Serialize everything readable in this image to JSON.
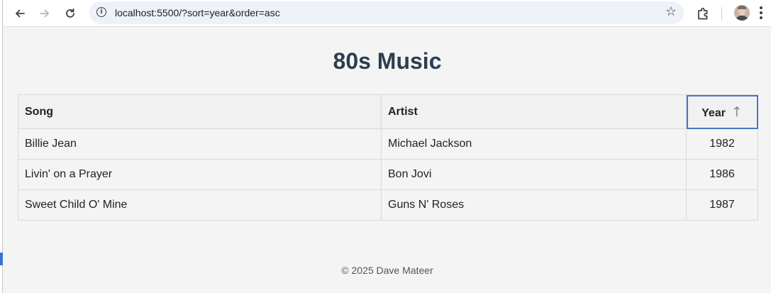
{
  "browser": {
    "url": "localhost:5500/?sort=year&order=asc"
  },
  "page": {
    "title": "80s Music",
    "footer": "© 2025 Dave Mateer"
  },
  "table": {
    "headers": {
      "song": "Song",
      "artist": "Artist",
      "year": "Year",
      "year_sort_indicator": "↑"
    },
    "rows": [
      {
        "song": "Billie Jean",
        "artist": "Michael Jackson",
        "year": "1982"
      },
      {
        "song": "Livin' on a Prayer",
        "artist": "Bon Jovi",
        "year": "1986"
      },
      {
        "song": "Sweet Child O' Mine",
        "artist": "Guns N' Roses",
        "year": "1987"
      }
    ]
  },
  "icons": {
    "back": "arrow-left-icon",
    "forward": "arrow-right-icon",
    "reload": "reload-icon",
    "site_info": "info-icon",
    "bookmark": "star-icon",
    "extensions": "puzzle-piece-icon",
    "profile": "avatar",
    "menu": "kebab-menu-icon"
  },
  "colors": {
    "title": "#2c3e50",
    "active_sort_outline": "#4a76c4",
    "page_background": "#f4f4f4"
  }
}
